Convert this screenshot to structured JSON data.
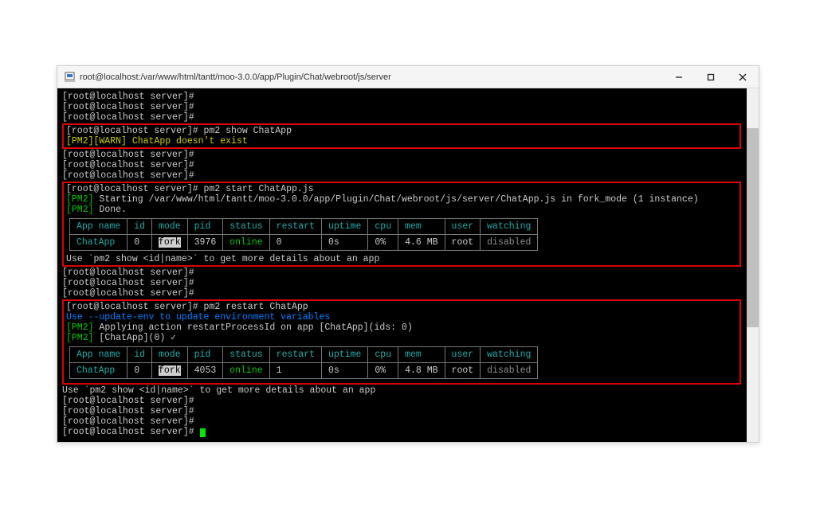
{
  "window": {
    "title": "root@localhost:/var/www/html/tantt/moo-3.0.0/app/Plugin/Chat/webroot/js/server"
  },
  "prompts": {
    "p": "[root@localhost server]#",
    "cmd_show": "pm2 show ChatApp",
    "cmd_start": "pm2 start ChatApp.js",
    "cmd_restart": "pm2 restart ChatApp"
  },
  "msgs": {
    "warn_prefix": "[PM2][WARN]",
    "warn_noexist": " ChatApp doesn't exist",
    "pm2_prefix": "[PM2]",
    "starting": " Starting /var/www/html/tantt/moo-3.0.0/app/Plugin/Chat/webroot/js/server/ChatApp.js in fork_mode (1 instance)",
    "done": " Done.",
    "update_env": "Use --update-env to update environment variables",
    "applying": " Applying action restartProcessId on app [ChatApp](ids: 0)",
    "restarted": " [ChatApp](0) ✓",
    "hint": "Use `pm2 show <id|name>` to get more details about an app"
  },
  "headers": {
    "app_name": "App name",
    "id": "id",
    "mode": "mode",
    "pid": "pid",
    "status": "status",
    "restart": "restart",
    "uptime": "uptime",
    "cpu": "cpu",
    "mem": "mem",
    "user": "user",
    "watching": "watching"
  },
  "row1": {
    "app_name": "ChatApp",
    "id": "0",
    "mode": "fork",
    "pid": "3976",
    "status": "online",
    "restart": "0",
    "uptime": "0s",
    "cpu": "0%",
    "mem": "4.6 MB",
    "user": "root",
    "watching": "disabled"
  },
  "row2": {
    "app_name": "ChatApp",
    "id": "0",
    "mode": "fork",
    "pid": "4053",
    "status": "online",
    "restart": "1",
    "uptime": "0s",
    "cpu": "0%",
    "mem": "4.8 MB",
    "user": "root",
    "watching": "disabled"
  }
}
